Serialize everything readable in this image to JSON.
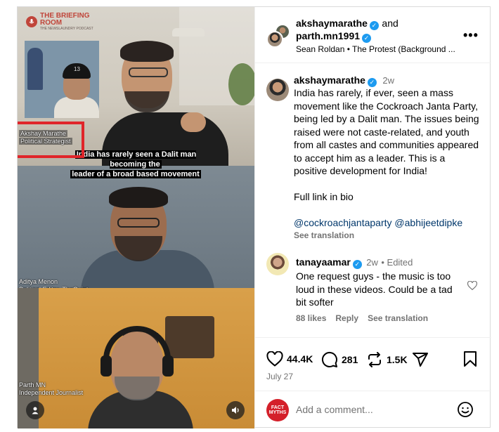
{
  "video": {
    "brand": {
      "line1": "THE BRIEFING",
      "line2": "ROOM",
      "sub": "THE NEWSLAUNDRY PODCAST"
    },
    "inset_cap_logo": "13",
    "speaker1": {
      "name": "Akshay Marathe",
      "role": "Political Strategist"
    },
    "subtitle_line1": "India has rarely seen a Dalit man becoming the",
    "subtitle_line2": "leader of a broad based movement",
    "speaker2": {
      "name": "Aditya Menon",
      "role": "Political Editor, TheQuint"
    },
    "speaker3": {
      "name": "Parth MN",
      "role": "Independent Journalist"
    },
    "icons": {
      "volume": "speaker-icon",
      "user": "user-icon"
    }
  },
  "post": {
    "author1": "akshaymarathe",
    "joiner": "and",
    "author2": "parth.mn1991",
    "audio": "Sean Roldan • The Protest (Background ...",
    "more": "•••",
    "caption": {
      "username": "akshaymarathe",
      "age": "2w",
      "text": "India has rarely, if ever, seen a mass movement like the Cockroach Janta Party, being led by a Dalit man. The issues being raised were not caste-related, and youth from all castes and communities appeared to accept him as a leader. This is a positive development for India!",
      "link_line": "Full link in bio",
      "mention1": "@cockroachjantaparty",
      "mention2": "@abhijeetdipke",
      "see_translation": "See translation"
    },
    "comment": {
      "username": "tanayaamar",
      "age": "2w",
      "edited": "• Edited",
      "text": "One request guys - the music is too loud in these videos. Could be a tad bit softer",
      "likes": "88 likes",
      "reply": "Reply",
      "see_translation": "See translation"
    },
    "stats": {
      "likes": "44.4K",
      "comments": "281",
      "reposts": "1.5K"
    },
    "date": "July 27",
    "add_comment_placeholder": "Add a comment...",
    "commenter_avatar_text": "FACT MYTHS"
  },
  "colors": {
    "accent_red": "#e0252a",
    "link": "#00376b",
    "muted": "#737373",
    "verified": "#1d9bf0"
  }
}
